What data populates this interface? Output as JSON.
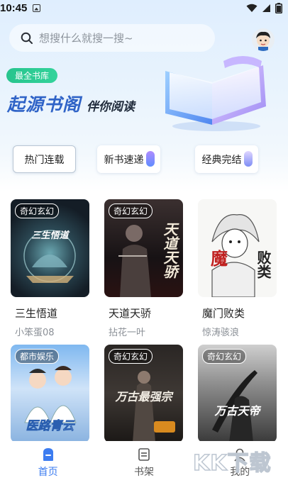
{
  "status": {
    "time": "10:45"
  },
  "search": {
    "placeholder": "想搜什么就搜一搜~"
  },
  "hero": {
    "badge": "最全书库",
    "brand": "起源书阁",
    "slogan": "伴你阅读"
  },
  "chips": [
    {
      "label": "热门连载",
      "active": true
    },
    {
      "label": "新书速递",
      "active": false
    },
    {
      "label": "经典完结",
      "active": false
    }
  ],
  "books": [
    {
      "title": "三生悟道",
      "author": "小笨蛋08",
      "genre": "奇幻玄幻",
      "cover_text": "三生悟道"
    },
    {
      "title": "天道天骄",
      "author": "拈花一叶",
      "genre": "奇幻玄幻",
      "cover_text": "天道天骄"
    },
    {
      "title": "魔门败类",
      "author": "惊涛骇浪",
      "genre": "奇幻玄幻",
      "cover_text": "败类"
    },
    {
      "title": "医路青云",
      "author": "",
      "genre": "都市娱乐",
      "cover_text": "医路青云"
    },
    {
      "title": "万古最强宗",
      "author": "",
      "genre": "奇幻玄幻",
      "cover_text": "万古最强宗"
    },
    {
      "title": "万古天帝",
      "author": "",
      "genre": "奇幻玄幻",
      "cover_text": "万古天帝"
    }
  ],
  "nav": [
    {
      "label": "首页",
      "icon": "home-icon",
      "active": true
    },
    {
      "label": "书架",
      "icon": "bookshelf-icon",
      "active": false
    },
    {
      "label": "我的",
      "icon": "profile-icon",
      "active": false
    }
  ],
  "watermark": "KK下载",
  "colors": {
    "accent": "#3c7cf0",
    "badge": "#2dc993",
    "brand": "#2f63c7"
  }
}
